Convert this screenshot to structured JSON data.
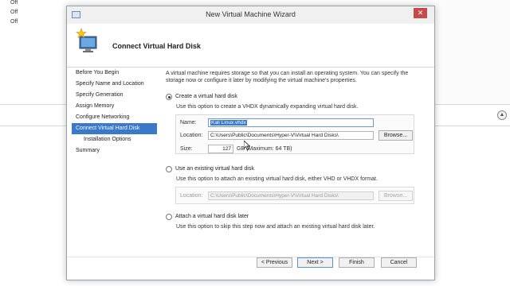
{
  "background": {
    "status_rows": [
      "Off",
      "Off",
      "Off"
    ],
    "scroll_button_glyph": "▲"
  },
  "dialog": {
    "title": "New Virtual Machine Wizard",
    "close_glyph": "✕",
    "header_title": "Connect Virtual Hard Disk"
  },
  "nav": {
    "items": [
      {
        "label": "Before You Begin",
        "active": false
      },
      {
        "label": "Specify Name and Location",
        "active": false
      },
      {
        "label": "Specify Generation",
        "active": false
      },
      {
        "label": "Assign Memory",
        "active": false
      },
      {
        "label": "Configure Networking",
        "active": false
      },
      {
        "label": "Connect Virtual Hard Disk",
        "active": true
      },
      {
        "label": "Installation Options",
        "active": false
      },
      {
        "label": "Summary",
        "active": false
      }
    ]
  },
  "content": {
    "description": "A virtual machine requires storage so that you can install an operating system. You can specify the storage now or configure it later by modifying the virtual machine's properties.",
    "create_option": {
      "label": "Create a virtual hard disk",
      "selected": true,
      "description": "Use this option to create a VHDX dynamically expanding virtual hard disk.",
      "name_label": "Name:",
      "name_value": "Kali Linux.vhdx",
      "location_label": "Location:",
      "location_value": "C:\\Users\\Public\\Documents\\Hyper-V\\Virtual Hard Disks\\",
      "browse_label": "Browse...",
      "size_label": "Size:",
      "size_value": "127",
      "size_unit": "GB (Maximum: 64 TB)"
    },
    "existing_option": {
      "label": "Use an existing virtual hard disk",
      "selected": false,
      "description": "Use this option to attach an existing virtual hard disk, either VHD or VHDX format.",
      "location_label": "Location:",
      "location_value": "C:\\Users\\Public\\Documents\\Hyper-V\\Virtual Hard Disks\\",
      "browse_label": "Browse..."
    },
    "later_option": {
      "label": "Attach a virtual hard disk later",
      "selected": false,
      "description": "Use this option to skip this step now and attach an existing virtual hard disk later."
    }
  },
  "footer": {
    "previous_label": "< Previous",
    "next_label": "Next >",
    "finish_label": "Finish",
    "cancel_label": "Cancel"
  },
  "colors": {
    "accent": "#3a78c9",
    "close_button": "#c74a4a"
  },
  "icons": {
    "app": "hyper-v-icon",
    "wizard": "monitor-star-icon",
    "cursor": "mouse-cursor-icon"
  }
}
